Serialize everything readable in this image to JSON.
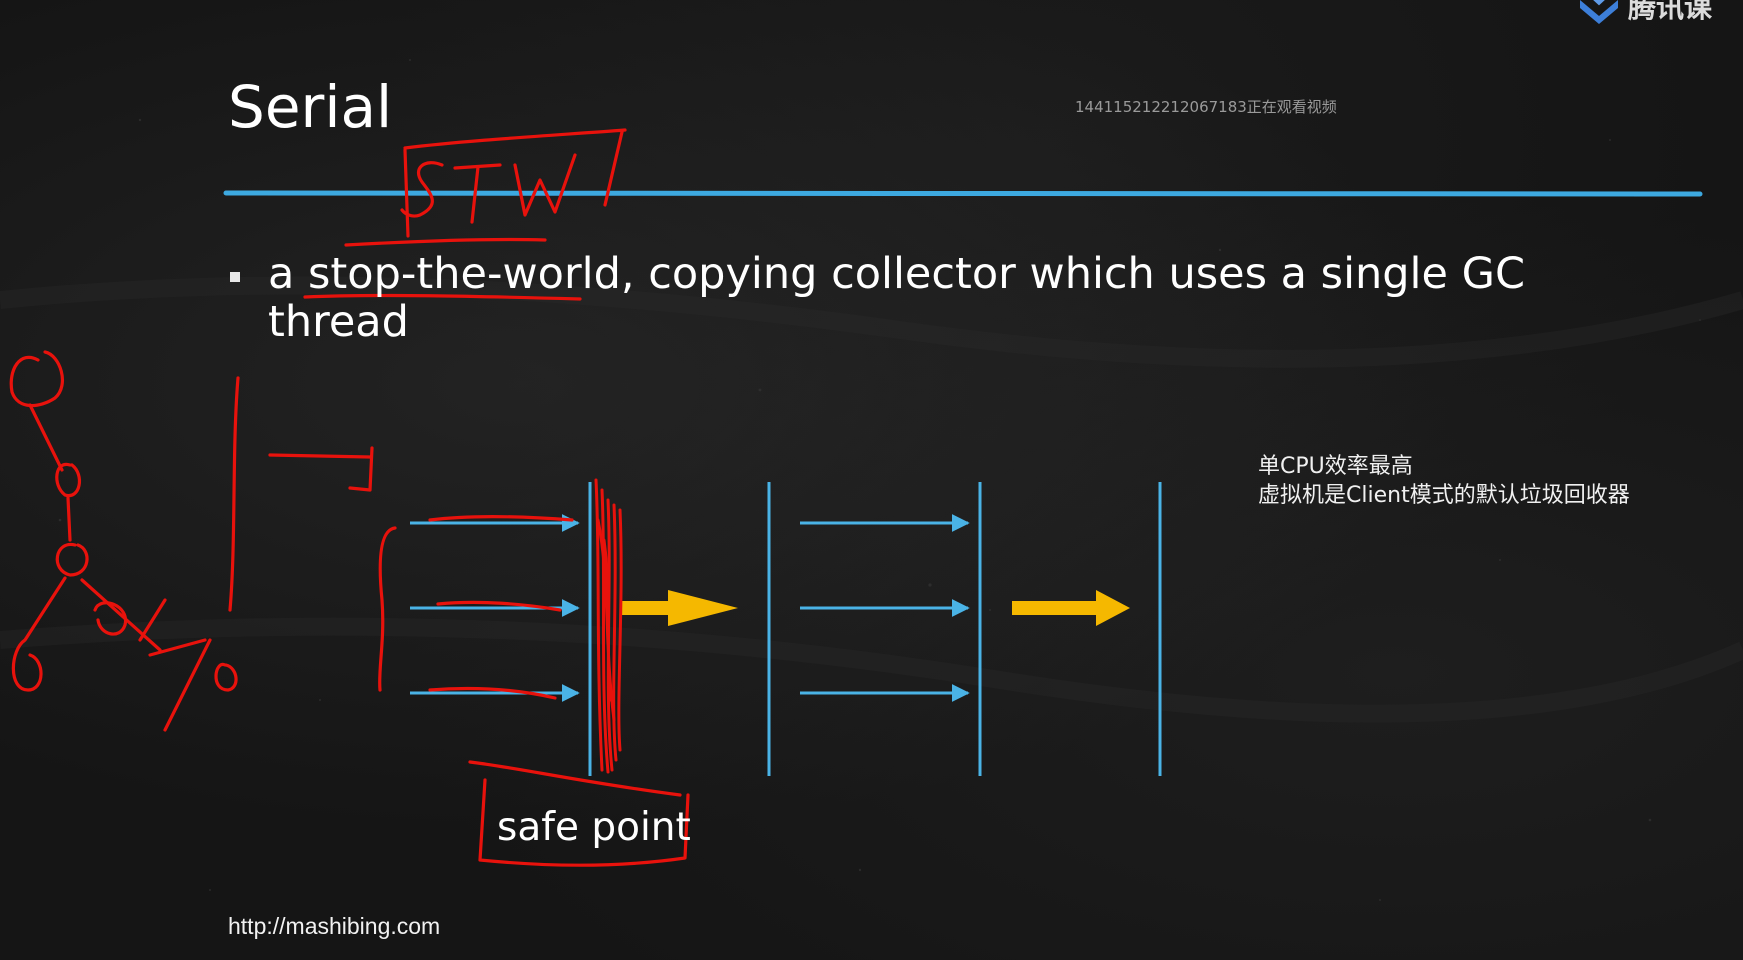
{
  "slide": {
    "title": "Serial",
    "watermark": "144115212212067183正在观看视频",
    "bullet": "a stop-the-world, copying collector which uses a single GC thread",
    "note_line1": "单CPU效率最高",
    "note_line2": "虚拟机是Client模式的默认垃圾回收器",
    "safe_point_label": "safe point",
    "footer_url": "http://mashibing.com"
  },
  "annotations": {
    "handwritten_stw": "STW"
  },
  "logo": {
    "text": "腾讯课"
  },
  "colors": {
    "background": "#151515",
    "accent_blue": "#4ab3e6",
    "arrow_yellow": "#f5b800",
    "annotation_red": "#e8120c"
  }
}
